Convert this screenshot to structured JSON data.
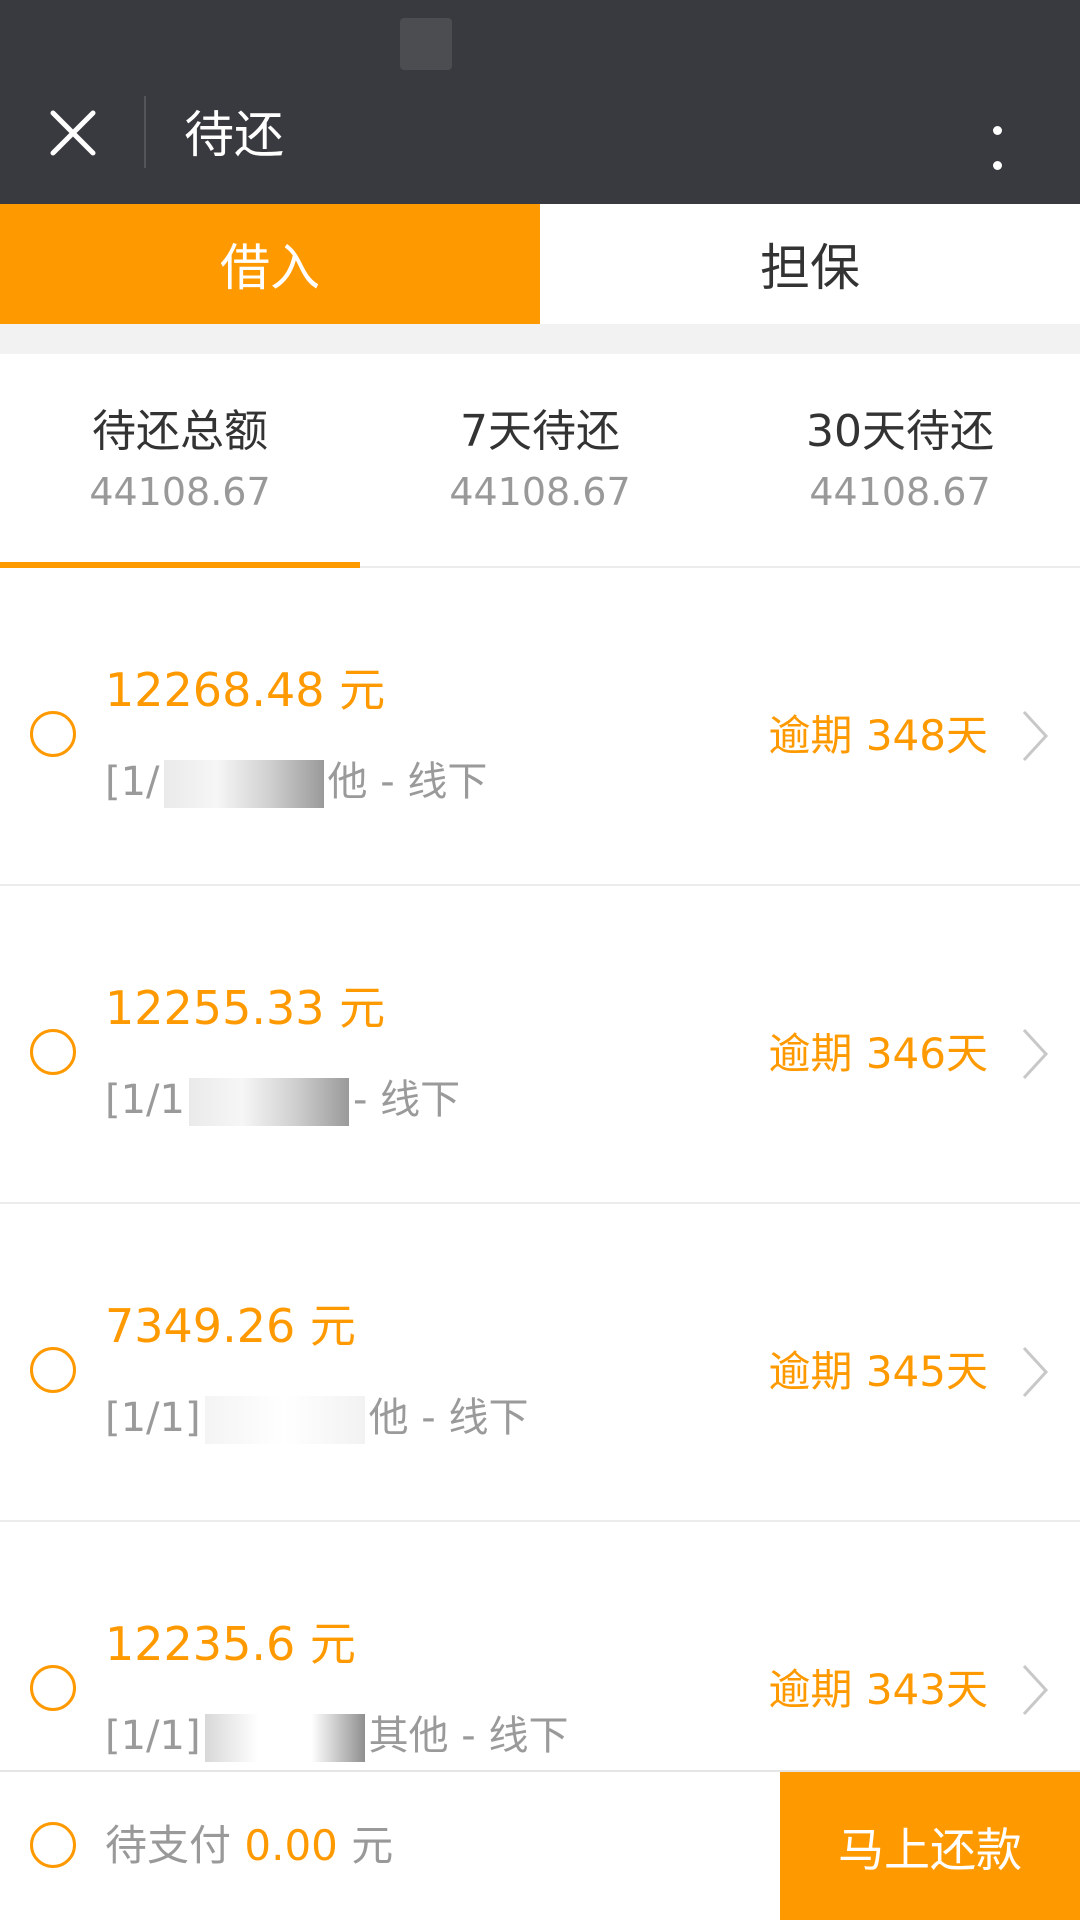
{
  "nav": {
    "title": "待还",
    "close_icon": "close-icon",
    "more_icon": "more-vertical-icon"
  },
  "tabs": [
    {
      "label": "借入",
      "active": true
    },
    {
      "label": "担保",
      "active": false
    }
  ],
  "summary": [
    {
      "label": "待还总额",
      "value": "44108.67",
      "active": true
    },
    {
      "label": "7天待还",
      "value": "44108.67",
      "active": false
    },
    {
      "label": "30天待还",
      "value": "44108.67",
      "active": false
    }
  ],
  "items": [
    {
      "amount": "12268.48 元",
      "desc_prefix": "[1/",
      "desc_suffix": "他 - 线下",
      "overdue": "逾期 348天"
    },
    {
      "amount": "12255.33 元",
      "desc_prefix": "[1/1",
      "desc_suffix": "- 线下",
      "overdue": "逾期 346天"
    },
    {
      "amount": "7349.26 元",
      "desc_prefix": "[1/1]",
      "desc_suffix": "他 - 线下",
      "overdue": "逾期 345天"
    },
    {
      "amount": "12235.6 元",
      "desc_prefix": "[1/1]",
      "desc_suffix": "其他 - 线下",
      "overdue": "逾期 343天"
    }
  ],
  "bottom": {
    "pay_label": "待支付",
    "pay_amount": "0.00",
    "pay_unit": "元",
    "repay_label": "马上还款"
  },
  "colors": {
    "accent": "#ff9900",
    "navbar": "#393a3f"
  }
}
